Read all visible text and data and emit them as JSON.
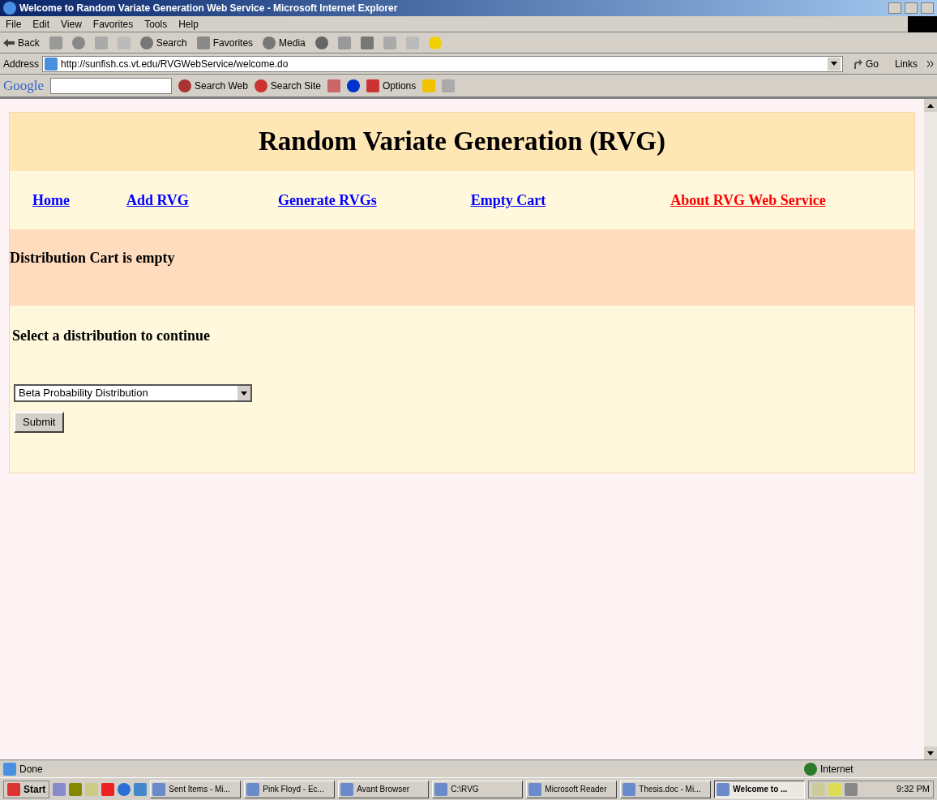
{
  "window": {
    "title": "Welcome to Random Variate Generation Web Service - Microsoft Internet Explorer"
  },
  "menu": [
    "File",
    "Edit",
    "View",
    "Favorites",
    "Tools",
    "Help"
  ],
  "toolbar": {
    "back": "Back",
    "search": "Search",
    "favorites": "Favorites",
    "media": "Media"
  },
  "address": {
    "label": "Address",
    "url": "http://sunfish.cs.vt.edu/RVGWebService/welcome.do",
    "go": "Go",
    "links": "Links"
  },
  "google_bar": {
    "logo": "Google",
    "search_web": "Search Web",
    "search_site": "Search Site",
    "options": "Options"
  },
  "page": {
    "heading": "Random Variate Generation (RVG)",
    "nav": [
      {
        "label": "Home",
        "color": "#0000ff"
      },
      {
        "label": "Add RVG",
        "color": "#0000ff"
      },
      {
        "label": "Generate RVGs",
        "color": "#0000ff"
      },
      {
        "label": "Empty Cart",
        "color": "#0000ff"
      },
      {
        "label": "About RVG Web Service",
        "color": "#ff0000"
      }
    ],
    "cart_status": "Distribution Cart is empty",
    "prompt": "Select a distribution to continue",
    "distribution": "Beta Probability Distribution",
    "submit": "Submit"
  },
  "status_bar": {
    "text": "Done",
    "zone": "Internet"
  },
  "taskbar": {
    "start": "Start",
    "tasks": [
      {
        "label": "Sent Items - Mi...",
        "selected": false
      },
      {
        "label": "Pink Floyd - Ec...",
        "selected": false
      },
      {
        "label": "Avant Browser",
        "selected": false
      },
      {
        "label": "C:\\RVG",
        "selected": false
      },
      {
        "label": "Microsoft Reader",
        "selected": false
      },
      {
        "label": "Thesis.doc - Mi...",
        "selected": false
      },
      {
        "label": "Welcome to ...",
        "selected": true
      }
    ],
    "clock": "9:32 PM"
  }
}
